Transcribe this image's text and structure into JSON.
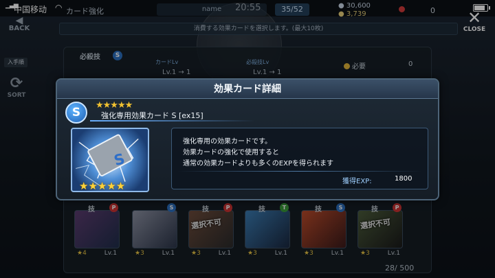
{
  "status_bar": {
    "carrier": "中国移动",
    "signal": "4G",
    "time": "20:55"
  },
  "top_bar": {
    "screen_title": "カード強化",
    "name_placeholder": "name",
    "card_count": "35/52",
    "currency_1": "30,600",
    "currency_2": "3,739",
    "gems": "0",
    "back_label": "BACK",
    "close_label": "CLOSE"
  },
  "instruction": "消費する効果カードを選択します。(最大10枚)",
  "sidebar": {
    "acquired_label": "入手順",
    "sort_label": "SORT"
  },
  "background_panel": {
    "skill_label": "必殺技",
    "skill_type": "S",
    "card_lv_label": "カードLv",
    "card_lv_value": "Lv.1 → 1",
    "skill_lv_label": "必殺技Lv",
    "skill_lv_value": "Lv.1 → 1",
    "need_label": "必要",
    "need_value": "0",
    "page_count": "28/ 500",
    "cards": [
      {
        "tag": "技",
        "badge": "P",
        "badge_type": "p",
        "stars": "★4",
        "lv": "Lv.1",
        "lock": ""
      },
      {
        "tag": "",
        "badge": "S",
        "badge_type": "s",
        "stars": "★3",
        "lv": "Lv.1",
        "lock": ""
      },
      {
        "tag": "技",
        "badge": "P",
        "badge_type": "p",
        "stars": "★3",
        "lv": "Lv.1",
        "lock": "選択不可"
      },
      {
        "tag": "技",
        "badge": "T",
        "badge_type": "t",
        "stars": "★3",
        "lv": "Lv.1",
        "lock": ""
      },
      {
        "tag": "技",
        "badge": "S",
        "badge_type": "s",
        "stars": "★3",
        "lv": "Lv.1",
        "lock": ""
      },
      {
        "tag": "技",
        "badge": "P",
        "badge_type": "p",
        "stars": "★3",
        "lv": "Lv.1",
        "lock": "選択不可"
      }
    ]
  },
  "modal": {
    "title": "効果カード詳細",
    "type_badge": "S",
    "rarity_stars": "★★★★★",
    "card_name": "強化専用効果カード S [ex15]",
    "card_image_stars": "★★★★★",
    "description_lines": [
      "強化専用の効果カードです。",
      "効果カードの強化で使用すると",
      "通常の効果カードよりも多くのEXPを得られます"
    ],
    "exp_label": "獲得EXP:",
    "exp_value": "1800"
  },
  "colors": {
    "accent_blue": "#2b6fbf",
    "star_gold": "#f2c230",
    "panel_border": "#4d6478"
  }
}
